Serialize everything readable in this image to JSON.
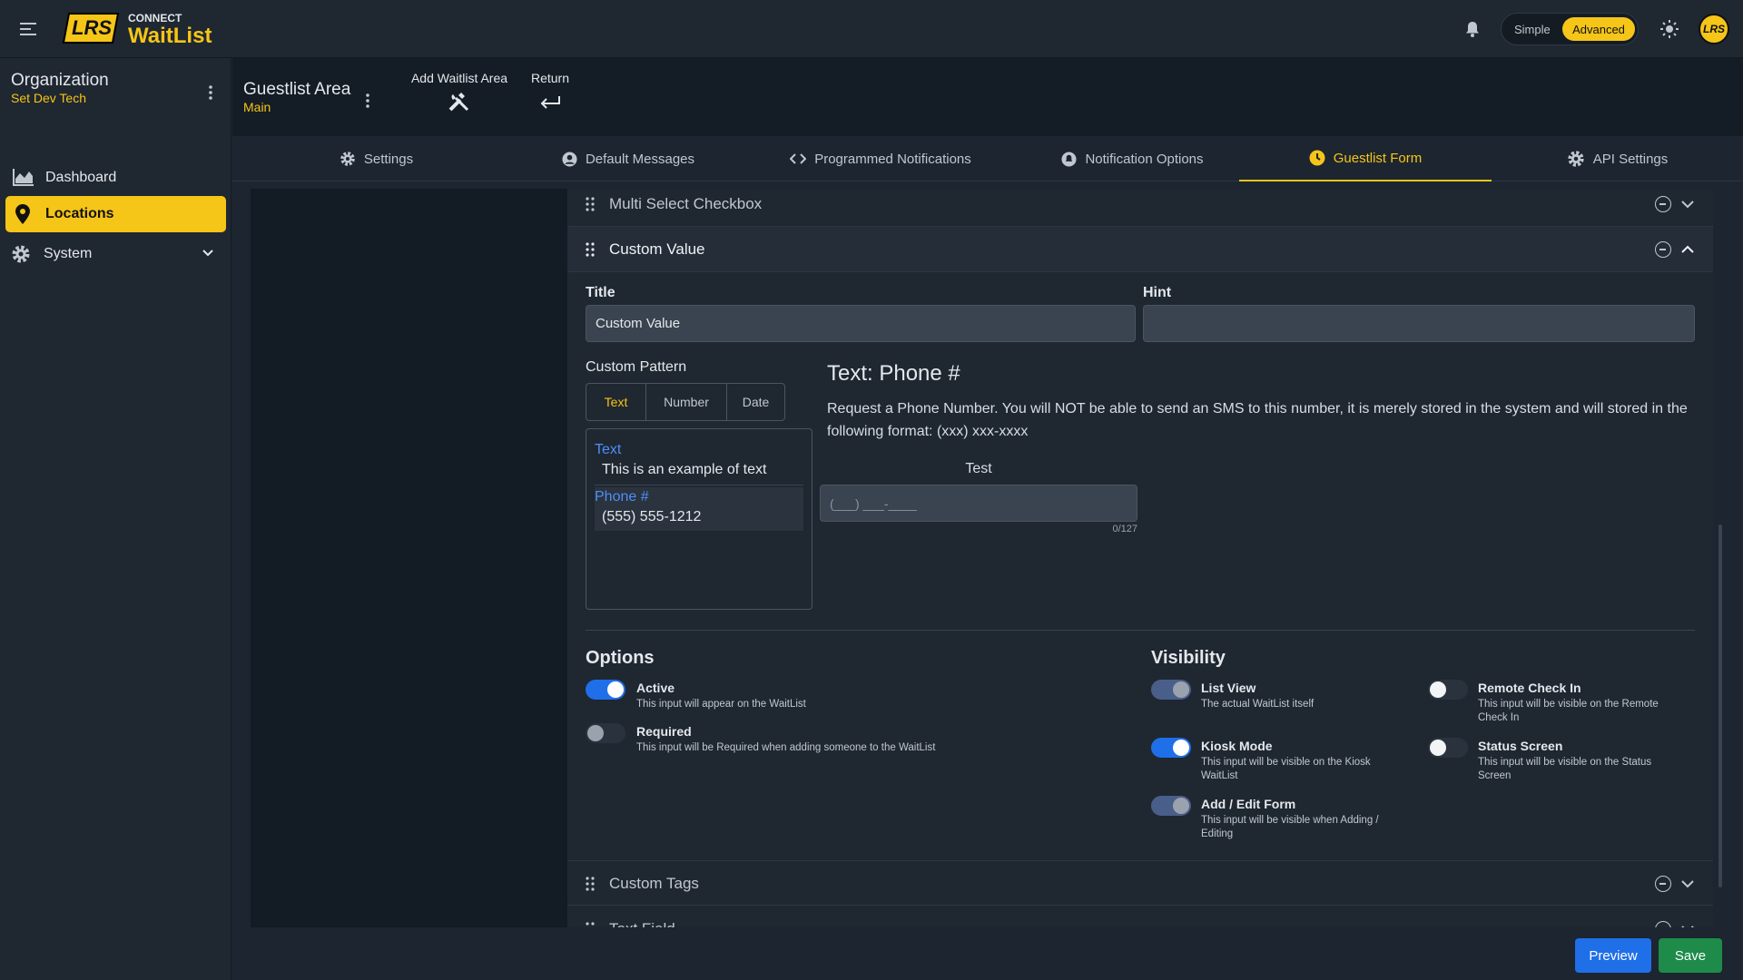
{
  "app": {
    "brand_small": "CONNECT",
    "brand_name": "WaitList",
    "logo_text": "LRS",
    "avatar_text": "LRS"
  },
  "mode_toggle": {
    "simple_label": "Simple",
    "advanced_label": "Advanced",
    "selected": "Advanced"
  },
  "sidebar": {
    "org_title": "Organization",
    "org_subtitle": "Set Dev Tech",
    "items": [
      {
        "label": "Dashboard",
        "icon": "chart-area-icon"
      },
      {
        "label": "Locations",
        "icon": "location-pin-icon",
        "active": true
      },
      {
        "label": "System",
        "icon": "gear-icon"
      }
    ]
  },
  "subheader": {
    "area_title": "Guestlist Area",
    "area_subtitle": "Main",
    "add_label": "Add Waitlist Area",
    "return_label": "Return"
  },
  "tabs": [
    {
      "label": "Settings",
      "icon": "gear-small-icon"
    },
    {
      "label": "Default Messages",
      "icon": "user-circle-icon"
    },
    {
      "label": "Programmed Notifications",
      "icon": "code-icon"
    },
    {
      "label": "Notification Options",
      "icon": "bell-circle-icon"
    },
    {
      "label": "Guestlist Form",
      "icon": "clock-icon",
      "active": true
    },
    {
      "label": "API Settings",
      "icon": "gear-icon"
    }
  ],
  "accordion": {
    "multi_select": "Multi Select Checkbox",
    "custom_value": "Custom Value",
    "custom_tags": "Custom Tags",
    "text_field": "Text Field"
  },
  "form": {
    "title_label": "Title",
    "title_value": "Custom Value",
    "hint_label": "Hint",
    "hint_value": "",
    "pattern_label": "Custom Pattern",
    "pattern_tabs": [
      "Text",
      "Number",
      "Date"
    ],
    "pattern_selected": "Text",
    "patterns": [
      {
        "name": "Text",
        "example": "This is an example of text"
      },
      {
        "name": "Phone #",
        "example": "(555) 555-1212"
      }
    ],
    "preview_title": "Text: Phone #",
    "preview_desc": "Request a Phone Number. You will NOT be able to send an SMS to this number, it is merely stored in the system and will stored in the following format: (xxx) xxx-xxxx",
    "test_label": "Test",
    "test_placeholder": "(___) ___-____",
    "counter": "0/127"
  },
  "options": {
    "heading": "Options",
    "items": [
      {
        "title": "Active",
        "desc": "This input will appear on the WaitList",
        "on": true
      },
      {
        "title": "Required",
        "desc": "This input will be Required when adding someone to the WaitList",
        "on": false
      }
    ]
  },
  "visibility": {
    "heading": "Visibility",
    "items": [
      {
        "title": "List View",
        "desc": "The actual WaitList itself",
        "on": true
      },
      {
        "title": "Remote Check In",
        "desc": "This input will be visible on the Remote Check In",
        "on": false
      },
      {
        "title": "Kiosk Mode",
        "desc": "This input will be visible on the Kiosk WaitList",
        "on": true
      },
      {
        "title": "Status Screen",
        "desc": "This input will be visible on the Status Screen",
        "on": false
      },
      {
        "title": "Add / Edit Form",
        "desc": "This input will be visible when Adding / Editing",
        "on": true
      }
    ]
  },
  "actions": {
    "preview_label": "Preview",
    "save_label": "Save"
  },
  "colors": {
    "accent": "#f5c518",
    "primary": "#1f6fe8",
    "save": "#1e8b4a",
    "link": "#4f8ef7"
  }
}
